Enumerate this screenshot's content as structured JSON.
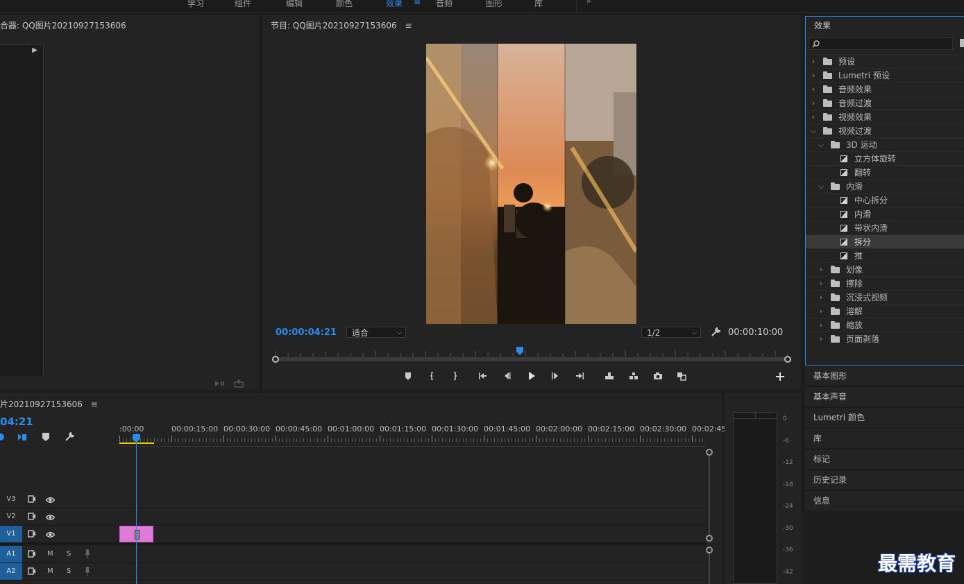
{
  "workspace_tabs": [
    "学习",
    "组件",
    "编辑",
    "颜色",
    "效果",
    "音频",
    "图形",
    "库"
  ],
  "workspace_active": "效果",
  "source": {
    "title": "合器: QQ图片20210927153606"
  },
  "program": {
    "title": "节目: QQ图片20210927153606",
    "menu_glyph": "≡",
    "timecode": "00:00:04:21",
    "fit": "适合",
    "resolution": "1/2",
    "duration": "00:00:10:00",
    "playhead_fraction": 0.477
  },
  "effects": {
    "title": "效果",
    "search_placeholder": "",
    "tree": [
      {
        "label": "预设",
        "level": 0,
        "type": "preset-folder",
        "expanded": false
      },
      {
        "label": "Lumetri 预设",
        "level": 0,
        "type": "preset-folder",
        "expanded": false
      },
      {
        "label": "音频效果",
        "level": 0,
        "type": "folder",
        "expanded": false
      },
      {
        "label": "音频过渡",
        "level": 0,
        "type": "folder",
        "expanded": false
      },
      {
        "label": "视频效果",
        "level": 0,
        "type": "folder",
        "expanded": false
      },
      {
        "label": "视频过渡",
        "level": 0,
        "type": "folder",
        "expanded": true
      },
      {
        "label": "3D 运动",
        "level": 1,
        "type": "folder",
        "expanded": true
      },
      {
        "label": "立方体旋转",
        "level": 2,
        "type": "effect"
      },
      {
        "label": "翻转",
        "level": 2,
        "type": "effect"
      },
      {
        "label": "内滑",
        "level": 1,
        "type": "folder",
        "expanded": true
      },
      {
        "label": "中心拆分",
        "level": 2,
        "type": "effect"
      },
      {
        "label": "内滑",
        "level": 2,
        "type": "effect"
      },
      {
        "label": "带状内滑",
        "level": 2,
        "type": "effect"
      },
      {
        "label": "拆分",
        "level": 2,
        "type": "effect",
        "selected": true
      },
      {
        "label": "推",
        "level": 2,
        "type": "effect"
      },
      {
        "label": "划像",
        "level": 1,
        "type": "folder",
        "expanded": false
      },
      {
        "label": "擦除",
        "level": 1,
        "type": "folder",
        "expanded": false
      },
      {
        "label": "沉浸式视频",
        "level": 1,
        "type": "folder",
        "expanded": false
      },
      {
        "label": "溶解",
        "level": 1,
        "type": "folder",
        "expanded": false
      },
      {
        "label": "缩放",
        "level": 1,
        "type": "folder",
        "expanded": false
      },
      {
        "label": "页面剥落",
        "level": 1,
        "type": "folder",
        "expanded": false
      }
    ]
  },
  "side_panels": [
    "基本图形",
    "基本声音",
    "Lumetri 颜色",
    "库",
    "标记",
    "历史记录",
    "信息"
  ],
  "timeline": {
    "title": "片20210927153606",
    "menu_glyph": "≡",
    "timecode": "04:21",
    "ruler": [
      ":00:00",
      "00:00:15:00",
      "00:00:30:00",
      "00:00:45:00",
      "00:01:00:00",
      "00:01:15:00",
      "00:01:30:00",
      "00:01:45:00",
      "00:02:00:00",
      "00:02:15:00",
      "00:02:30:00",
      "00:02:45:"
    ],
    "video_tracks": [
      "V3",
      "V2",
      "V1"
    ],
    "audio_tracks": [
      "A1",
      "A2"
    ],
    "mute_label": "M",
    "solo_label": "S",
    "clip_color": "#e07ad9"
  },
  "meter": {
    "labels": [
      "0",
      "-6",
      "-12",
      "-18",
      "-24",
      "-30",
      "-36",
      "-42"
    ]
  },
  "watermark": "最需教育",
  "colors": {
    "accent": "#2d8ceb",
    "panel": "#232323",
    "bg": "#1d1d1d"
  }
}
